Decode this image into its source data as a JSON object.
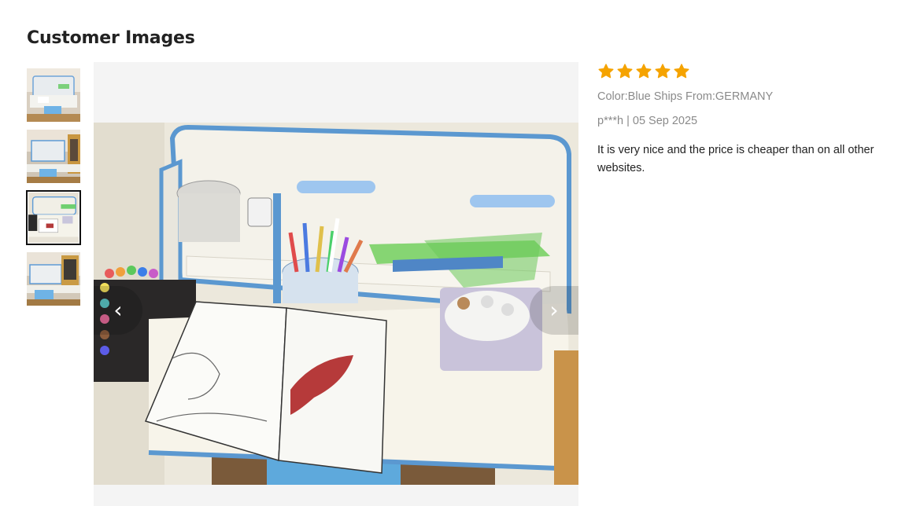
{
  "section": {
    "title": "Customer Images"
  },
  "thumbnails": [
    {
      "name": "thumbnail-1",
      "active": false
    },
    {
      "name": "thumbnail-2",
      "active": false
    },
    {
      "name": "thumbnail-3",
      "active": true
    },
    {
      "name": "thumbnail-4",
      "active": false
    }
  ],
  "viewer": {
    "prev_icon": "chevron-left-icon",
    "next_icon": "chevron-right-icon",
    "prev_glyph": "‹",
    "next_glyph": "›"
  },
  "review": {
    "rating": 5,
    "star_color": "#f5a300",
    "color_ships": "Color:Blue Ships From:GERMANY",
    "author_date": "p***h | 05 Sep 2025",
    "text": "It is very nice and the price is cheaper than on all other websites."
  }
}
